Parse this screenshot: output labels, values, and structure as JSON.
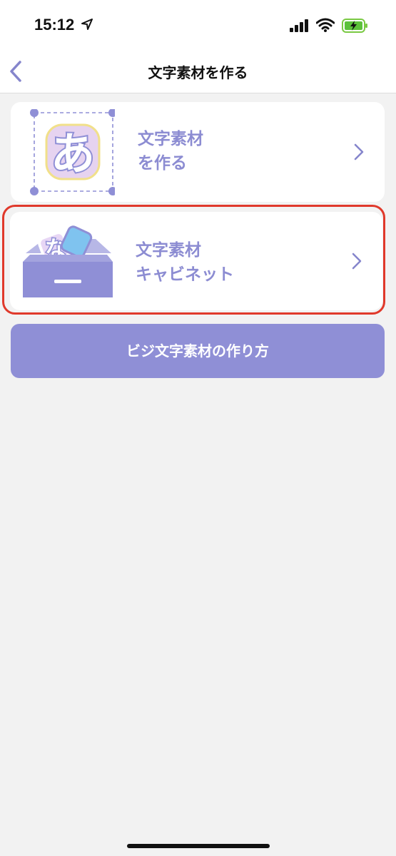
{
  "status_bar": {
    "time": "15:12"
  },
  "nav": {
    "title": "文字素材を作る"
  },
  "cards": [
    {
      "line1": "文字素材",
      "line2": "を作る",
      "art_glyph": "あ"
    },
    {
      "line1": "文字素材",
      "line2": "キャビネット",
      "art_glyph": "な"
    }
  ],
  "how_to_button": {
    "label": "ビジ文字素材の作り方"
  },
  "colors": {
    "accent": "#8f8fd6",
    "highlight": "#e0392b",
    "background": "#f2f2f2"
  }
}
